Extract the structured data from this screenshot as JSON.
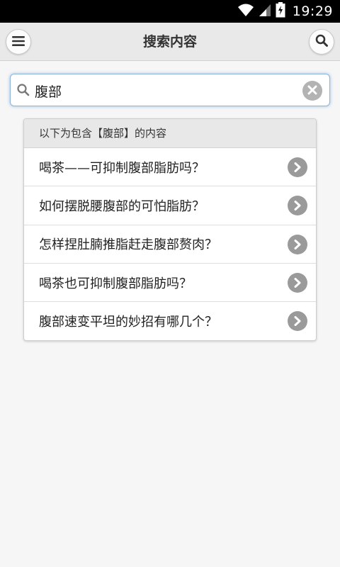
{
  "status_bar": {
    "time": "19:29",
    "icons": [
      "wifi-icon",
      "signal-icon",
      "battery-icon"
    ]
  },
  "header": {
    "title": "搜索内容",
    "menu_icon": "menu-icon",
    "search_icon": "search-icon"
  },
  "search": {
    "value": "腹部",
    "clear_icon": "clear-icon"
  },
  "results": {
    "header": "以下为包含【腹部】的内容",
    "items": [
      {
        "label": "喝茶——可抑制腹部脂肪吗？"
      },
      {
        "label": "如何摆脱腰腹部的可怕脂肪？"
      },
      {
        "label": "怎样捏肚腩推脂赶走腹部赘肉？"
      },
      {
        "label": "喝茶也可抑制腹部脂肪吗？"
      },
      {
        "label": "腹部速变平坦的妙招有哪几个？"
      }
    ]
  },
  "colors": {
    "header_bg": "#e9e9e9",
    "page_bg": "#f6f6f6",
    "search_focus": "#8fb4d9",
    "chevron_bg": "#9a9a9a"
  }
}
